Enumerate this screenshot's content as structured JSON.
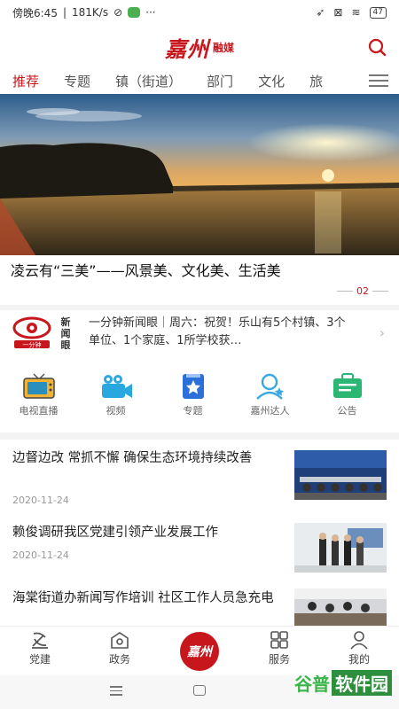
{
  "status": {
    "time": "傍晚6:45",
    "speed": "181K/s",
    "dots": "···",
    "battery": "47"
  },
  "header": {
    "logo": "嘉州",
    "logo_sub": "融媒"
  },
  "tabs": [
    "推荐",
    "专题",
    "镇（街道）",
    "部门",
    "文化",
    "旅"
  ],
  "banner": {
    "caption": "凌云有“三美”——风景美、文化美、生活美",
    "page": "02"
  },
  "news_eye": {
    "text": "一分钟新闻眼｜周六：祝贺！乐山有5个村镇、3个单位、1个家庭、1所学校获…",
    "logo_main": "新闻眼",
    "logo_sub": "一分钟"
  },
  "quick": [
    {
      "label": "电视直播",
      "icon": "tv-icon",
      "color": "#2a8fbd"
    },
    {
      "label": "视频",
      "icon": "video-camera-icon",
      "color": "#29a8e0"
    },
    {
      "label": "专题",
      "icon": "star-book-icon",
      "color": "#2b6fd8"
    },
    {
      "label": "嘉州达人",
      "icon": "person-star-icon",
      "color": "#39a9e6"
    },
    {
      "label": "公告",
      "icon": "notice-bag-icon",
      "color": "#2bb673"
    }
  ],
  "articles": [
    {
      "title": "边督边改 常抓不懈 确保生态环境持续改善",
      "date": "2020-11-24"
    },
    {
      "title": "赖俊调研我区党建引领产业发展工作",
      "date": "2020-11-24"
    },
    {
      "title": "海棠街道办新闻写作培训 社区工作人员急充电",
      "date": ""
    }
  ],
  "tabbar": [
    {
      "label": "党建",
      "icon": "party-icon"
    },
    {
      "label": "政务",
      "icon": "government-icon"
    },
    {
      "label": "",
      "icon": "home-logo-icon",
      "logo": "嘉州"
    },
    {
      "label": "服务",
      "icon": "grid-icon"
    },
    {
      "label": "我的",
      "icon": "user-icon"
    }
  ],
  "watermark": {
    "a": "谷普",
    "b": "软件园"
  },
  "colors": {
    "accent": "#c8161d"
  }
}
